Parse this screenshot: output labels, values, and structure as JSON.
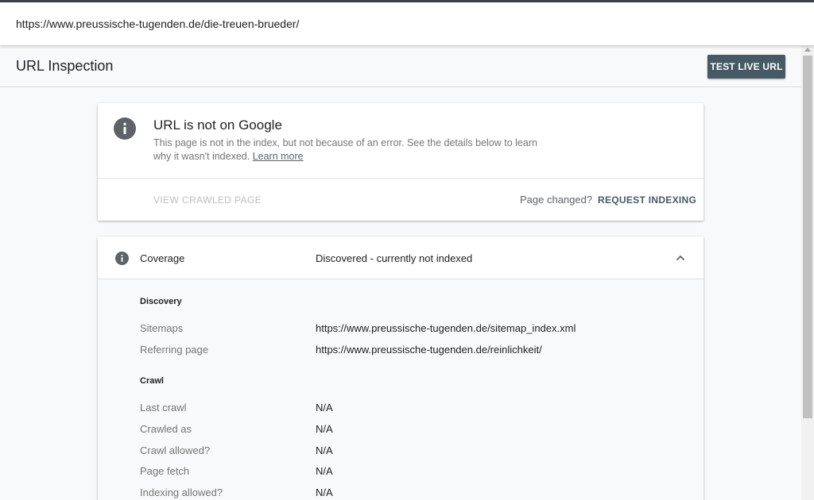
{
  "urlbar": {
    "url": "https://www.preussische-tugenden.de/die-treuen-brueder/"
  },
  "header": {
    "title": "URL Inspection",
    "test_live_url": "TEST LIVE URL"
  },
  "status_card": {
    "icon": "info-icon",
    "title": "URL is not on Google",
    "description": "This page is not in the index, but not because of an error. See the details below to learn why it wasn't indexed.",
    "learn_more": "Learn more",
    "view_crawled_page": "VIEW CRAWLED PAGE",
    "page_changed": "Page changed?",
    "request_indexing": "REQUEST INDEXING"
  },
  "coverage": {
    "icon": "info-icon",
    "label": "Coverage",
    "value": "Discovered - currently not indexed",
    "expanded": true,
    "discovery": {
      "heading": "Discovery",
      "rows": [
        {
          "label": "Sitemaps",
          "value": "https://www.preussische-tugenden.de/sitemap_index.xml"
        },
        {
          "label": "Referring page",
          "value": "https://www.preussische-tugenden.de/reinlichkeit/"
        }
      ]
    },
    "crawl": {
      "heading": "Crawl",
      "rows": [
        {
          "label": "Last crawl",
          "value": "N/A"
        },
        {
          "label": "Crawled as",
          "value": "N/A"
        },
        {
          "label": "Crawl allowed?",
          "value": "N/A"
        },
        {
          "label": "Page fetch",
          "value": "N/A"
        },
        {
          "label": "Indexing allowed?",
          "value": "N/A"
        }
      ]
    }
  },
  "colors": {
    "accent": "#455a64",
    "icon_gray": "#5f6368",
    "muted_text": "#757575",
    "background": "#f8f9fa"
  }
}
